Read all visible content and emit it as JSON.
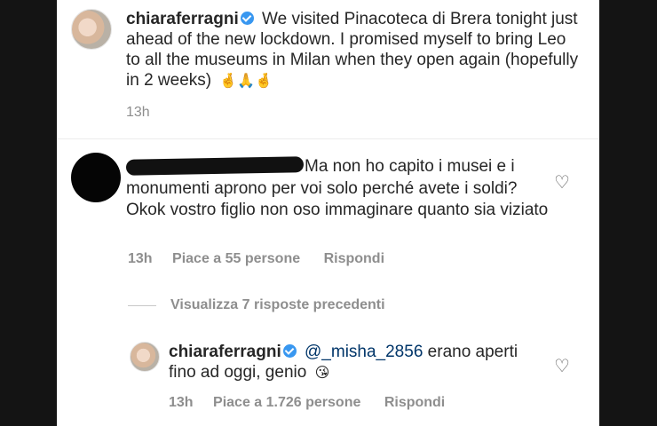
{
  "caption": {
    "username": "chiaraferragni",
    "text": "We visited Pinacoteca di Brera tonight just ahead of the new lockdown. I promised myself to bring Leo to all the museums in Milan when they open again (hopefully in 2 weeks)",
    "emojis": "🤞🙏🤞",
    "time": "13h"
  },
  "comment": {
    "text_line1": "Ma non ho capito i musei e i",
    "text_rest": "monumenti aprono per voi solo perché avete i soldi? Okok vostro figlio non oso immaginare quanto sia viziato",
    "time": "13h",
    "likes": "Piace a 55 persone",
    "reply_label": "Rispondi"
  },
  "view_replies": "Visualizza 7 risposte precedenti",
  "reply": {
    "username": "chiaraferragni",
    "mention": "@_misha_2856",
    "text": "erano aperti fino ad oggi, genio",
    "emoji": "😘",
    "time": "13h",
    "likes": "Piace a 1.726 persone",
    "reply_label": "Rispondi"
  },
  "colors": {
    "background": "#141414",
    "panel": "#ffffff",
    "text": "#262626",
    "muted": "#8e8e8e",
    "verified": "#3897f0",
    "mention": "#003569"
  }
}
